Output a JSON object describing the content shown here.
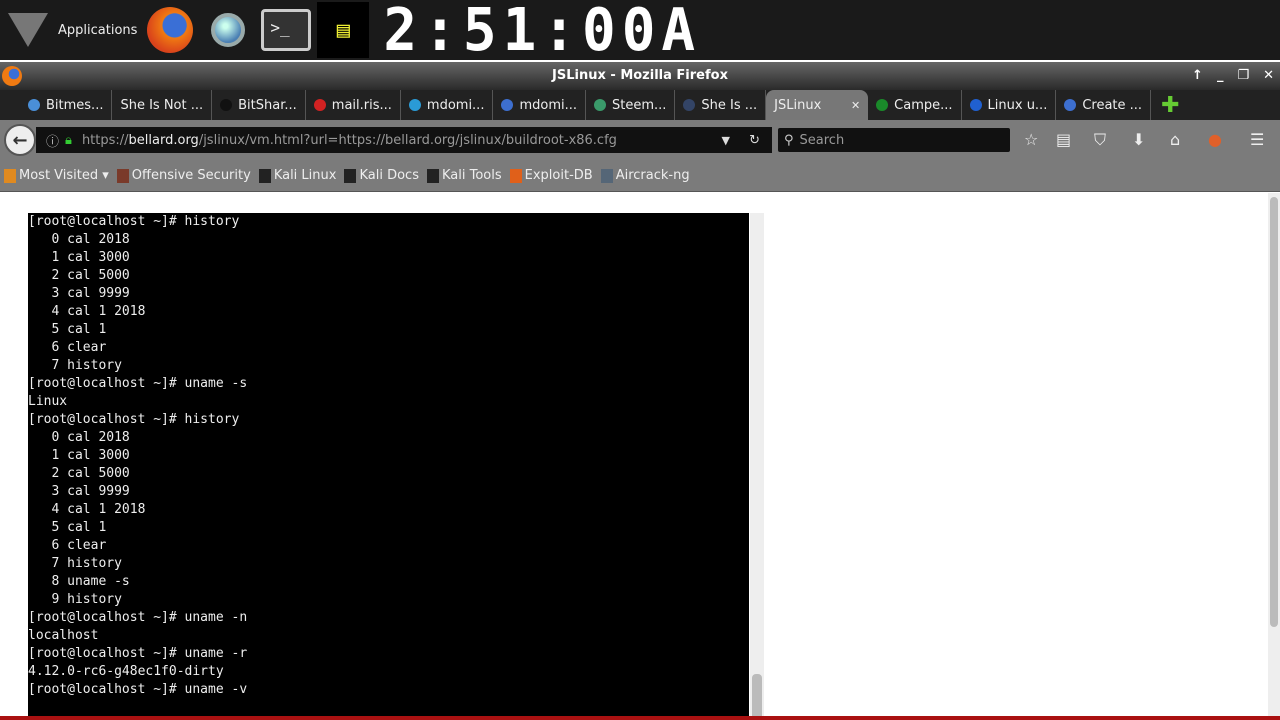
{
  "panel": {
    "applications_label": "Applications",
    "cpu_monitor": "cpu",
    "clock": "2:51:00A"
  },
  "window": {
    "title": "JSLinux - Mozilla Firefox",
    "controls": [
      "↑",
      "_",
      "❐",
      "✕"
    ]
  },
  "tabs": [
    {
      "label": "Bitmes...",
      "icon_color": "#4a8fd8"
    },
    {
      "label": "She Is Not ...",
      "icon_color": ""
    },
    {
      "label": "BitShar...",
      "icon_color": "#111111"
    },
    {
      "label": "mail.ris...",
      "icon_color": "#d22222"
    },
    {
      "label": "mdomi...",
      "icon_color": "#2a9bd6"
    },
    {
      "label": "mdomi...",
      "icon_color": "#3d6fd0"
    },
    {
      "label": "Steem...",
      "icon_color": "#3a9a6a"
    },
    {
      "label": "She Is ...",
      "icon_color": "#334466"
    },
    {
      "label": "JSLinux",
      "active": true,
      "close": "✕"
    },
    {
      "label": "Campe...",
      "icon_color": "#1a8a2a"
    },
    {
      "label": "Linux u...",
      "icon_color": "#2060d0"
    },
    {
      "label": "Create ...",
      "icon_color": "#3d6fd0"
    }
  ],
  "nav": {
    "url_prefix": "https://",
    "url_domain": "bellard.org",
    "url_rest": "/jslinux/vm.html?url=https://bellard.org/jslinux/buildroot-x86.cfg",
    "search_placeholder": "Search"
  },
  "bookmarks": [
    {
      "label": "Most Visited ▾",
      "icon_color": "#e08a20"
    },
    {
      "label": "Offensive Security",
      "icon_color": "#7a3a2a"
    },
    {
      "label": "Kali Linux",
      "icon_color": "#222222"
    },
    {
      "label": "Kali Docs",
      "icon_color": "#222222"
    },
    {
      "label": "Kali Tools",
      "icon_color": "#222222"
    },
    {
      "label": "Exploit-DB",
      "icon_color": "#e0601a"
    },
    {
      "label": "Aircrack-ng",
      "icon_color": "#556677"
    }
  ],
  "terminal": {
    "lines": [
      "[root@localhost ~]# history",
      "   0 cal 2018",
      "   1 cal 3000",
      "   2 cal 5000",
      "   3 cal 9999",
      "   4 cal 1 2018",
      "   5 cal 1",
      "   6 clear",
      "   7 history",
      "[root@localhost ~]# uname -s",
      "Linux",
      "[root@localhost ~]# history",
      "   0 cal 2018",
      "   1 cal 3000",
      "   2 cal 5000",
      "   3 cal 9999",
      "   4 cal 1 2018",
      "   5 cal 1",
      "   6 clear",
      "   7 history",
      "   8 uname -s",
      "   9 history",
      "[root@localhost ~]# uname -n",
      "localhost",
      "[root@localhost ~]# uname -r",
      "4.12.0-rc6-g48ec1f0-dirty",
      "[root@localhost ~]# uname -v"
    ]
  }
}
